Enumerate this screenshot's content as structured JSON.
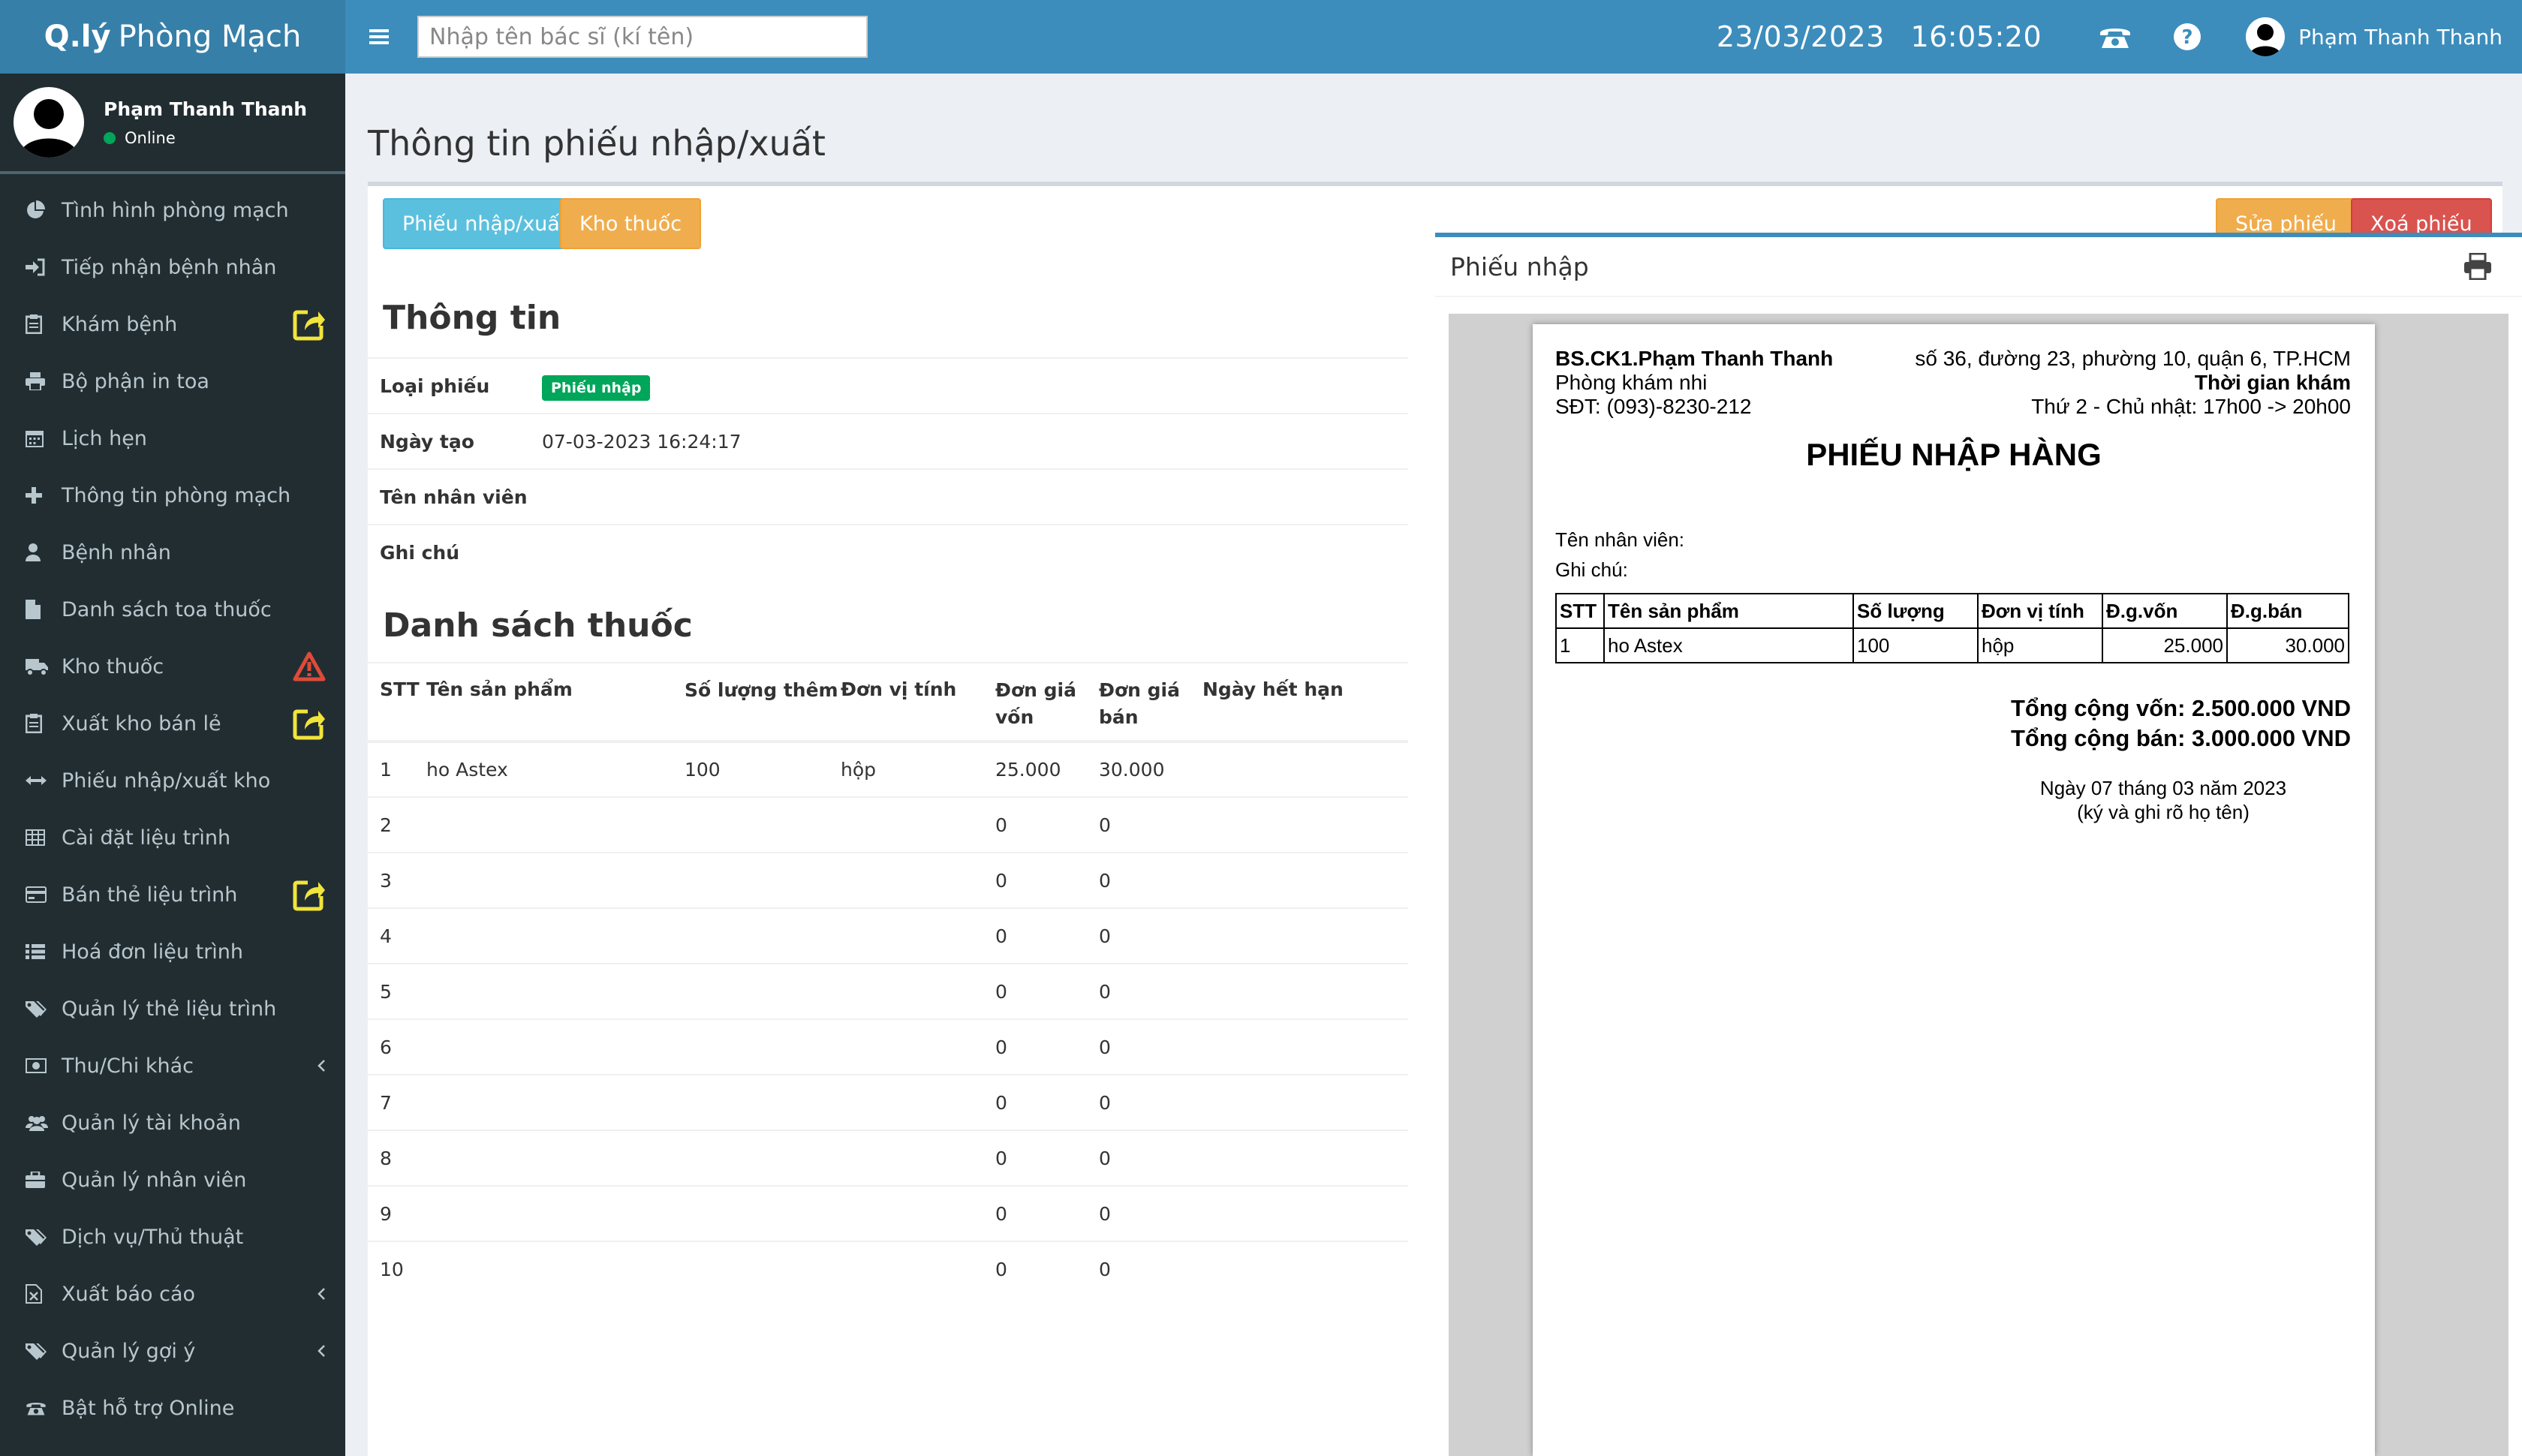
{
  "brand": {
    "bold": "Q.lý",
    "light": "Phòng Mạch"
  },
  "header": {
    "search_placeholder": "Nhập tên bác sĩ (kí tên)",
    "date": "23/03/2023",
    "time": "16:05:20",
    "user_name": "Phạm Thanh Thanh",
    "icons": [
      "menu-icon",
      "phone-icon",
      "help-icon"
    ]
  },
  "sidebar": {
    "user_name": "Phạm Thanh Thanh",
    "status": "Online",
    "items": [
      {
        "label": "Tình hình phòng mạch",
        "icon": "pie-chart-icon"
      },
      {
        "label": "Tiếp nhận bệnh nhân",
        "icon": "sign-in-icon"
      },
      {
        "label": "Khám bệnh",
        "icon": "clipboard-icon",
        "badge": "external-link-icon"
      },
      {
        "label": "Bộ phận in toa",
        "icon": "print-icon"
      },
      {
        "label": "Lịch hẹn",
        "icon": "calendar-icon"
      },
      {
        "label": "Thông tin phòng mạch",
        "icon": "plus-icon"
      },
      {
        "label": "Bệnh nhân",
        "icon": "user-icon"
      },
      {
        "label": "Danh sách toa thuốc",
        "icon": "file-icon"
      },
      {
        "label": "Kho thuốc",
        "icon": "truck-icon",
        "badge": "warning-icon"
      },
      {
        "label": "Xuất kho bán lẻ",
        "icon": "clipboard-icon",
        "badge": "external-link-icon"
      },
      {
        "label": "Phiếu nhập/xuất kho",
        "icon": "arrows-h-icon"
      },
      {
        "label": "Cài đặt liệu trình",
        "icon": "table-icon"
      },
      {
        "label": "Bán thẻ liệu trình",
        "icon": "credit-card-icon",
        "badge": "external-link-icon"
      },
      {
        "label": "Hoá đơn liệu trình",
        "icon": "list-icon"
      },
      {
        "label": "Quản lý thẻ liệu trình",
        "icon": "tags-icon"
      },
      {
        "label": "Thu/Chi khác",
        "icon": "money-icon",
        "chevron": true
      },
      {
        "label": "Quản lý tài khoản",
        "icon": "users-icon"
      },
      {
        "label": "Quản lý nhân viên",
        "icon": "briefcase-icon"
      },
      {
        "label": "Dịch vụ/Thủ thuật",
        "icon": "tags-icon"
      },
      {
        "label": "Xuất báo cáo",
        "icon": "file-excel-icon",
        "chevron": true
      },
      {
        "label": "Quản lý gợi ý",
        "icon": "tags-icon",
        "chevron": true
      },
      {
        "label": "Bật hỗ trợ Online",
        "icon": "phone-icon"
      }
    ],
    "colors": {
      "badge_yellow": "#f1e43b",
      "badge_red": "#dd4b39"
    }
  },
  "page": {
    "title": "Thông tin phiếu nhập/xuất",
    "buttons": {
      "tab_receipt": "Phiếu nhập/xuất",
      "tab_warehouse": "Kho thuốc",
      "edit": "Sửa phiếu",
      "delete": "Xoá phiếu"
    },
    "info": {
      "title": "Thông tin",
      "type_label": "Loại phiếu",
      "type_value": "Phiếu nhập",
      "date_label": "Ngày tạo",
      "date_value": "07-03-2023 16:24:17",
      "staff_label": "Tên nhân viên",
      "staff_value": "",
      "note_label": "Ghi chú",
      "note_value": ""
    },
    "medicines": {
      "title": "Danh sách thuốc",
      "headers": [
        "STT",
        "Tên sản phẩm",
        "Số lượng thêm",
        "Đơn vị tính",
        "Đơn giá vốn",
        "Đơn giá bán",
        "Ngày hết hạn"
      ],
      "rows": [
        [
          "1",
          "ho Astex",
          "100",
          "hộp",
          "25.000",
          "30.000",
          ""
        ],
        [
          "2",
          "",
          "",
          "",
          "0",
          "0",
          ""
        ],
        [
          "3",
          "",
          "",
          "",
          "0",
          "0",
          ""
        ],
        [
          "4",
          "",
          "",
          "",
          "0",
          "0",
          ""
        ],
        [
          "5",
          "",
          "",
          "",
          "0",
          "0",
          ""
        ],
        [
          "6",
          "",
          "",
          "",
          "0",
          "0",
          ""
        ],
        [
          "7",
          "",
          "",
          "",
          "0",
          "0",
          ""
        ],
        [
          "8",
          "",
          "",
          "",
          "0",
          "0",
          ""
        ],
        [
          "9",
          "",
          "",
          "",
          "0",
          "0",
          ""
        ],
        [
          "10",
          "",
          "",
          "",
          "0",
          "0",
          ""
        ]
      ]
    }
  },
  "preview": {
    "panel_title": "Phiếu nhập",
    "doctor": "BS.CK1.Phạm Thanh Thanh",
    "clinic": "Phòng khám nhi",
    "phone": "SĐT: (093)-8230-212",
    "address": "số 36, đường 23, phường 10, quận 6, TP.HCM",
    "hours_title": "Thời gian khám",
    "hours": "Thứ 2 - Chủ nhật: 17h00 -> 20h00",
    "doc_title": "PHIẾU NHẬP HÀNG",
    "staff": "Tên nhân viên:",
    "note": "Ghi chú:",
    "table_headers": [
      "STT",
      "Tên sản phẩm",
      "Số lượng",
      "Đơn vị tính",
      "Đ.g.vốn",
      "Đ.g.bán"
    ],
    "table_rows": [
      [
        "1",
        "ho Astex",
        "100",
        "hộp",
        "25.000",
        "30.000"
      ]
    ],
    "total_cost": "Tổng cộng vốn: 2.500.000 VND",
    "total_sale": "Tổng cộng bán: 3.000.000 VND",
    "sign_date": "Ngày 07 tháng 03 năm 2023",
    "sign_note": "(ký và ghi rõ họ tên)"
  },
  "colors": {
    "header": "#3c8dbc",
    "logo": "#367fa9",
    "sidebar": "#222d32",
    "online": "#00a65a"
  }
}
